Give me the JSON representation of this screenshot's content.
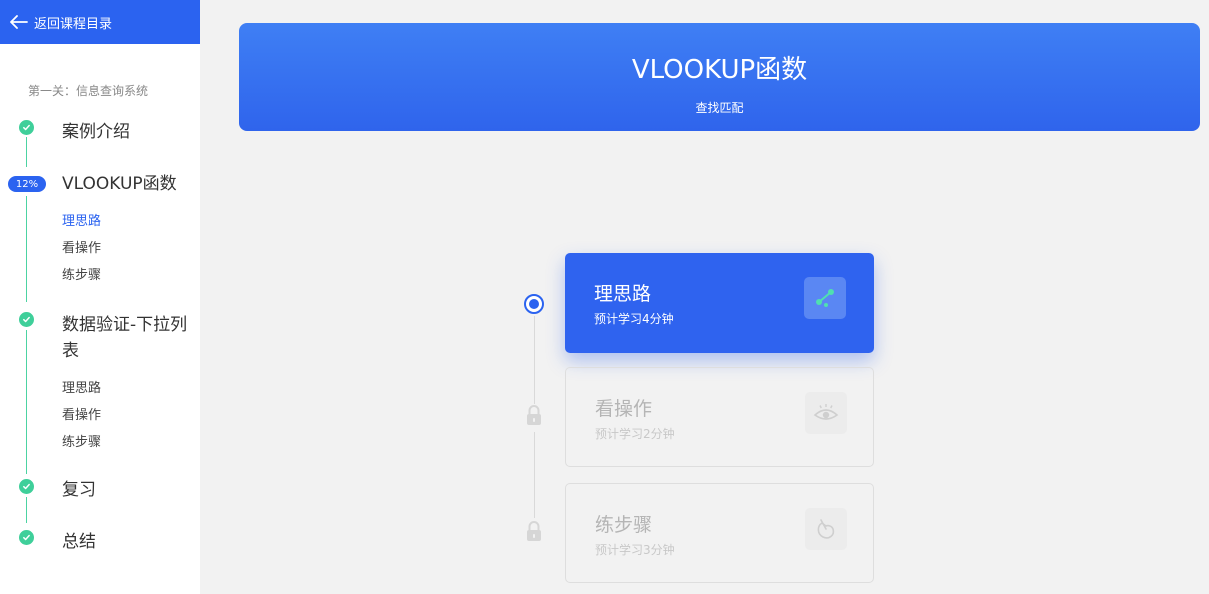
{
  "sidebar": {
    "back_label": "返回课程目录",
    "level_title": "第一关：信息查询系统",
    "progress_badge": "12%",
    "chapters": [
      {
        "label": "案例介绍",
        "status": "done"
      },
      {
        "label": "VLOOKUP函数",
        "status": "in-progress",
        "subs": [
          "理思路",
          "看操作",
          "练步骤"
        ]
      },
      {
        "label_line1": "数据验证-下拉列",
        "label_line2": "表",
        "status": "done",
        "subs": [
          "理思路",
          "看操作",
          "练步骤"
        ]
      },
      {
        "label": "复习",
        "status": "done"
      },
      {
        "label": "总结",
        "status": "done"
      }
    ]
  },
  "banner": {
    "title": "VLOOKUP函数",
    "subtitle": "查找匹配"
  },
  "steps": [
    {
      "title": "理思路",
      "duration": "预计学习4分钟",
      "state": "active",
      "icon": "path-node-icon"
    },
    {
      "title": "看操作",
      "duration": "预计学习2分钟",
      "state": "locked",
      "icon": "eye-icon"
    },
    {
      "title": "练步骤",
      "duration": "预计学习3分钟",
      "state": "locked",
      "icon": "mouse-icon"
    }
  ],
  "colors": {
    "accent": "#2b63f0",
    "check": "#3fcf9a",
    "node_green": "#4fe0b0"
  }
}
